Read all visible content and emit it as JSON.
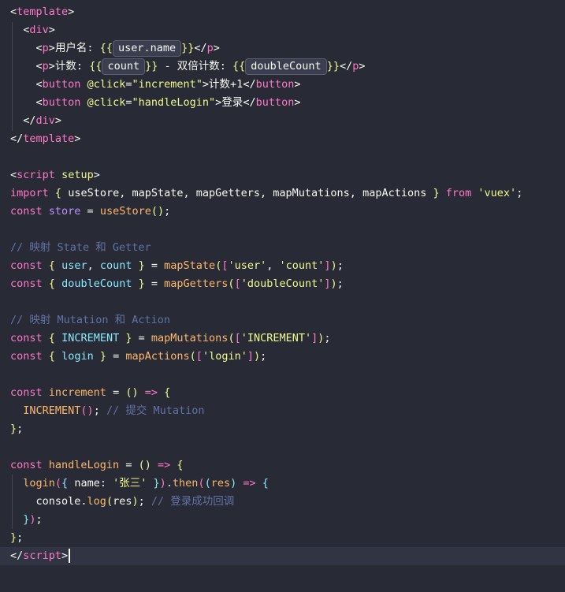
{
  "editor": {
    "lines": [
      [
        {
          "c": "t-punc",
          "t": "<"
        },
        {
          "c": "t-tag",
          "t": "template"
        },
        {
          "c": "t-punc",
          "t": ">"
        }
      ],
      [
        {
          "c": "t-plain",
          "t": "  "
        },
        {
          "c": "t-punc",
          "t": "<"
        },
        {
          "c": "t-tag",
          "t": "div"
        },
        {
          "c": "t-punc",
          "t": ">"
        }
      ],
      [
        {
          "c": "t-plain",
          "t": "    "
        },
        {
          "c": "t-punc",
          "t": "<"
        },
        {
          "c": "t-tag",
          "t": "p"
        },
        {
          "c": "t-punc",
          "t": ">"
        },
        {
          "c": "t-plain",
          "t": "用户名: "
        },
        {
          "c": "t-brace",
          "t": "{{"
        },
        {
          "c": "hint",
          "t": "user.name"
        },
        {
          "c": "t-brace",
          "t": "}}"
        },
        {
          "c": "t-punc",
          "t": "</"
        },
        {
          "c": "t-tag",
          "t": "p"
        },
        {
          "c": "t-punc",
          "t": ">"
        }
      ],
      [
        {
          "c": "t-plain",
          "t": "    "
        },
        {
          "c": "t-punc",
          "t": "<"
        },
        {
          "c": "t-tag",
          "t": "p"
        },
        {
          "c": "t-punc",
          "t": ">"
        },
        {
          "c": "t-plain",
          "t": "计数: "
        },
        {
          "c": "t-brace",
          "t": "{{"
        },
        {
          "c": "hint",
          "t": "count"
        },
        {
          "c": "t-brace",
          "t": "}}"
        },
        {
          "c": "t-plain",
          "t": " - 双倍计数: "
        },
        {
          "c": "t-brace",
          "t": "{{"
        },
        {
          "c": "hint",
          "t": "doubleCount"
        },
        {
          "c": "t-brace",
          "t": "}}"
        },
        {
          "c": "t-punc",
          "t": "</"
        },
        {
          "c": "t-tag",
          "t": "p"
        },
        {
          "c": "t-punc",
          "t": ">"
        }
      ],
      [
        {
          "c": "t-plain",
          "t": "    "
        },
        {
          "c": "t-punc",
          "t": "<"
        },
        {
          "c": "t-tag",
          "t": "button"
        },
        {
          "c": "t-plain",
          "t": " "
        },
        {
          "c": "t-attr",
          "t": "@click"
        },
        {
          "c": "t-punc",
          "t": "="
        },
        {
          "c": "t-str",
          "t": "\"increment\""
        },
        {
          "c": "t-punc",
          "t": ">"
        },
        {
          "c": "t-plain",
          "t": "计数+1"
        },
        {
          "c": "t-punc",
          "t": "</"
        },
        {
          "c": "t-tag",
          "t": "button"
        },
        {
          "c": "t-punc",
          "t": ">"
        }
      ],
      [
        {
          "c": "t-plain",
          "t": "    "
        },
        {
          "c": "t-punc",
          "t": "<"
        },
        {
          "c": "t-tag",
          "t": "button"
        },
        {
          "c": "t-plain",
          "t": " "
        },
        {
          "c": "t-attr",
          "t": "@click"
        },
        {
          "c": "t-punc",
          "t": "="
        },
        {
          "c": "t-str",
          "t": "\"handleLogin\""
        },
        {
          "c": "t-punc",
          "t": ">"
        },
        {
          "c": "t-plain",
          "t": "登录"
        },
        {
          "c": "t-punc",
          "t": "</"
        },
        {
          "c": "t-tag",
          "t": "button"
        },
        {
          "c": "t-punc",
          "t": ">"
        }
      ],
      [
        {
          "c": "t-plain",
          "t": "  "
        },
        {
          "c": "t-punc",
          "t": "</"
        },
        {
          "c": "t-tag",
          "t": "div"
        },
        {
          "c": "t-punc",
          "t": ">"
        }
      ],
      [
        {
          "c": "t-punc",
          "t": "</"
        },
        {
          "c": "t-tag",
          "t": "template"
        },
        {
          "c": "t-punc",
          "t": ">"
        }
      ],
      [],
      [
        {
          "c": "t-punc",
          "t": "<"
        },
        {
          "c": "t-tag",
          "t": "script"
        },
        {
          "c": "t-plain",
          "t": " "
        },
        {
          "c": "t-attr",
          "t": "setup"
        },
        {
          "c": "t-punc",
          "t": ">"
        }
      ],
      [
        {
          "c": "t-kw",
          "t": "import"
        },
        {
          "c": "t-plain",
          "t": " "
        },
        {
          "c": "t-brace",
          "t": "{"
        },
        {
          "c": "t-plain",
          "t": " useStore, mapState, mapGetters, mapMutations, mapActions "
        },
        {
          "c": "t-brace",
          "t": "}"
        },
        {
          "c": "t-plain",
          "t": " "
        },
        {
          "c": "t-kw",
          "t": "from"
        },
        {
          "c": "t-plain",
          "t": " "
        },
        {
          "c": "t-str",
          "t": "'vuex'"
        },
        {
          "c": "t-plain",
          "t": ";"
        }
      ],
      [
        {
          "c": "t-kw",
          "t": "const"
        },
        {
          "c": "t-plain",
          "t": " "
        },
        {
          "c": "t-var2",
          "t": "store"
        },
        {
          "c": "t-plain",
          "t": " = "
        },
        {
          "c": "t-fn",
          "t": "useStore"
        },
        {
          "c": "t-brace",
          "t": "()"
        },
        {
          "c": "t-plain",
          "t": ";"
        }
      ],
      [],
      [
        {
          "c": "t-cm",
          "t": "// 映射 State 和 Getter"
        }
      ],
      [
        {
          "c": "t-kw",
          "t": "const"
        },
        {
          "c": "t-plain",
          "t": " "
        },
        {
          "c": "t-brace",
          "t": "{"
        },
        {
          "c": "t-plain",
          "t": " "
        },
        {
          "c": "t-var",
          "t": "user"
        },
        {
          "c": "t-plain",
          "t": ", "
        },
        {
          "c": "t-var",
          "t": "count"
        },
        {
          "c": "t-plain",
          "t": " "
        },
        {
          "c": "t-brace",
          "t": "}"
        },
        {
          "c": "t-plain",
          "t": " = "
        },
        {
          "c": "t-fn",
          "t": "mapState"
        },
        {
          "c": "t-brace",
          "t": "("
        },
        {
          "c": "t-brace2",
          "t": "["
        },
        {
          "c": "t-str",
          "t": "'user'"
        },
        {
          "c": "t-plain",
          "t": ", "
        },
        {
          "c": "t-str",
          "t": "'count'"
        },
        {
          "c": "t-brace2",
          "t": "]"
        },
        {
          "c": "t-brace",
          "t": ")"
        },
        {
          "c": "t-plain",
          "t": ";"
        }
      ],
      [
        {
          "c": "t-kw",
          "t": "const"
        },
        {
          "c": "t-plain",
          "t": " "
        },
        {
          "c": "t-brace",
          "t": "{"
        },
        {
          "c": "t-plain",
          "t": " "
        },
        {
          "c": "t-var",
          "t": "doubleCount"
        },
        {
          "c": "t-plain",
          "t": " "
        },
        {
          "c": "t-brace",
          "t": "}"
        },
        {
          "c": "t-plain",
          "t": " = "
        },
        {
          "c": "t-fn",
          "t": "mapGetters"
        },
        {
          "c": "t-brace",
          "t": "("
        },
        {
          "c": "t-brace2",
          "t": "["
        },
        {
          "c": "t-str",
          "t": "'doubleCount'"
        },
        {
          "c": "t-brace2",
          "t": "]"
        },
        {
          "c": "t-brace",
          "t": ")"
        },
        {
          "c": "t-plain",
          "t": ";"
        }
      ],
      [],
      [
        {
          "c": "t-cm",
          "t": "// 映射 Mutation 和 Action"
        }
      ],
      [
        {
          "c": "t-kw",
          "t": "const"
        },
        {
          "c": "t-plain",
          "t": " "
        },
        {
          "c": "t-brace",
          "t": "{"
        },
        {
          "c": "t-plain",
          "t": " "
        },
        {
          "c": "t-var",
          "t": "INCREMENT"
        },
        {
          "c": "t-plain",
          "t": " "
        },
        {
          "c": "t-brace",
          "t": "}"
        },
        {
          "c": "t-plain",
          "t": " = "
        },
        {
          "c": "t-fn",
          "t": "mapMutations"
        },
        {
          "c": "t-brace",
          "t": "("
        },
        {
          "c": "t-brace2",
          "t": "["
        },
        {
          "c": "t-str",
          "t": "'INCREMENT'"
        },
        {
          "c": "t-brace2",
          "t": "]"
        },
        {
          "c": "t-brace",
          "t": ")"
        },
        {
          "c": "t-plain",
          "t": ";"
        }
      ],
      [
        {
          "c": "t-kw",
          "t": "const"
        },
        {
          "c": "t-plain",
          "t": " "
        },
        {
          "c": "t-brace",
          "t": "{"
        },
        {
          "c": "t-plain",
          "t": " "
        },
        {
          "c": "t-var",
          "t": "login"
        },
        {
          "c": "t-plain",
          "t": " "
        },
        {
          "c": "t-brace",
          "t": "}"
        },
        {
          "c": "t-plain",
          "t": " = "
        },
        {
          "c": "t-fn",
          "t": "mapActions"
        },
        {
          "c": "t-brace",
          "t": "("
        },
        {
          "c": "t-brace2",
          "t": "["
        },
        {
          "c": "t-str",
          "t": "'login'"
        },
        {
          "c": "t-brace2",
          "t": "]"
        },
        {
          "c": "t-brace",
          "t": ")"
        },
        {
          "c": "t-plain",
          "t": ";"
        }
      ],
      [],
      [
        {
          "c": "t-kw",
          "t": "const"
        },
        {
          "c": "t-plain",
          "t": " "
        },
        {
          "c": "t-fn",
          "t": "increment"
        },
        {
          "c": "t-plain",
          "t": " = "
        },
        {
          "c": "t-brace",
          "t": "()"
        },
        {
          "c": "t-plain",
          "t": " "
        },
        {
          "c": "t-kw",
          "t": "=>"
        },
        {
          "c": "t-plain",
          "t": " "
        },
        {
          "c": "t-brace",
          "t": "{"
        }
      ],
      [
        {
          "c": "t-plain",
          "t": "  "
        },
        {
          "c": "t-fn",
          "t": "INCREMENT"
        },
        {
          "c": "t-brace2",
          "t": "()"
        },
        {
          "c": "t-plain",
          "t": "; "
        },
        {
          "c": "t-cm",
          "t": "// 提交 Mutation"
        }
      ],
      [
        {
          "c": "t-brace",
          "t": "}"
        },
        {
          "c": "t-plain",
          "t": ";"
        }
      ],
      [],
      [
        {
          "c": "t-kw",
          "t": "const"
        },
        {
          "c": "t-plain",
          "t": " "
        },
        {
          "c": "t-fn",
          "t": "handleLogin"
        },
        {
          "c": "t-plain",
          "t": " = "
        },
        {
          "c": "t-brace",
          "t": "()"
        },
        {
          "c": "t-plain",
          "t": " "
        },
        {
          "c": "t-kw",
          "t": "=>"
        },
        {
          "c": "t-plain",
          "t": " "
        },
        {
          "c": "t-brace",
          "t": "{"
        }
      ],
      [
        {
          "c": "t-plain",
          "t": "  "
        },
        {
          "c": "t-fn",
          "t": "login"
        },
        {
          "c": "t-brace2",
          "t": "("
        },
        {
          "c": "t-brace3",
          "t": "{"
        },
        {
          "c": "t-plain",
          "t": " name: "
        },
        {
          "c": "t-str",
          "t": "'张三'"
        },
        {
          "c": "t-plain",
          "t": " "
        },
        {
          "c": "t-brace3",
          "t": "}"
        },
        {
          "c": "t-brace2",
          "t": ")"
        },
        {
          "c": "t-plain",
          "t": "."
        },
        {
          "c": "t-fn",
          "t": "then"
        },
        {
          "c": "t-brace2",
          "t": "("
        },
        {
          "c": "t-brace3",
          "t": "("
        },
        {
          "c": "t-orange",
          "t": "res"
        },
        {
          "c": "t-brace3",
          "t": ")"
        },
        {
          "c": "t-plain",
          "t": " "
        },
        {
          "c": "t-kw",
          "t": "=>"
        },
        {
          "c": "t-plain",
          "t": " "
        },
        {
          "c": "t-brace3",
          "t": "{"
        }
      ],
      [
        {
          "c": "t-plain",
          "t": "    "
        },
        {
          "c": "t-plain",
          "t": "console."
        },
        {
          "c": "t-fn",
          "t": "log"
        },
        {
          "c": "t-brace",
          "t": "("
        },
        {
          "c": "t-plain",
          "t": "res"
        },
        {
          "c": "t-brace",
          "t": ")"
        },
        {
          "c": "t-plain",
          "t": "; "
        },
        {
          "c": "t-cm",
          "t": "// 登录成功回调"
        }
      ],
      [
        {
          "c": "t-plain",
          "t": "  "
        },
        {
          "c": "t-brace3",
          "t": "}"
        },
        {
          "c": "t-brace2",
          "t": ")"
        },
        {
          "c": "t-plain",
          "t": ";"
        }
      ],
      [
        {
          "c": "t-brace",
          "t": "}"
        },
        {
          "c": "t-plain",
          "t": ";"
        }
      ],
      [
        {
          "c": "t-punc",
          "t": "</"
        },
        {
          "c": "t-tag",
          "t": "script"
        },
        {
          "c": "t-punc",
          "t": ">"
        },
        {
          "c": "caret",
          "t": ""
        }
      ]
    ],
    "active_line_index": 30
  }
}
